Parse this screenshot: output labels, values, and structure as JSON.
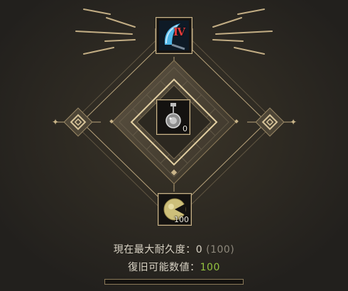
{
  "weapon_slot": {
    "icon": "scythe-icon",
    "enhance_label": "Ⅳ"
  },
  "center_slot": {
    "icon": "memory-fragment-pendant-icon",
    "count": "0"
  },
  "bottom_slot": {
    "icon": "artisans-memory-icon",
    "count": "100"
  },
  "current_max_durability": {
    "label": "現在最大耐久度：",
    "value": "0",
    "max": "(100)"
  },
  "recoverable": {
    "label": "復旧可能数値：",
    "value": "100"
  },
  "progress": {
    "fraction": 0
  },
  "colors": {
    "gold": "#c9b489",
    "green": "#93c23f",
    "background": "#22201d"
  }
}
